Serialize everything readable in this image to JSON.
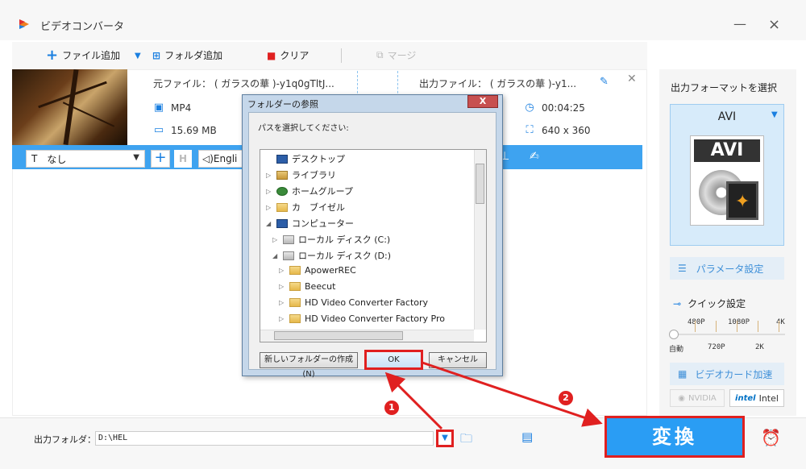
{
  "app": {
    "title": "ビデオコンバータ",
    "minimize_icon": "minimize-icon",
    "close_icon": "close-icon"
  },
  "toolbar": {
    "add_file_label": "ファイル追加",
    "add_folder_label": "フォルダ追加",
    "clear_label": "クリア",
    "merge_label": "マージ"
  },
  "file_item": {
    "source_label": "元ファイル： ( ガラスの華 )-y1q0gTltJ...",
    "output_label": "出力ファイル： ( ガラスの華 )-y1...",
    "format": "MP4",
    "size": "15.69 MB",
    "duration": "00:04:25",
    "resolution": "640 x 360",
    "subtitle_value": "なし",
    "audio_value": "Engli"
  },
  "right_panel": {
    "title": "出力フォーマットを選択",
    "format_name": "AVI",
    "format_image_text": "AVI",
    "param_button_label": "パラメータ設定",
    "quick_label": "クイック設定",
    "slider_top_ticks": [
      "480P",
      "1080P",
      "4K"
    ],
    "slider_bottom_ticks": [
      "自動",
      "720P",
      "2K"
    ],
    "gpu_label": "ビデオカード加速",
    "nvidia_label": "NVIDIA",
    "intel_logo": "intel",
    "intel_label": "Intel"
  },
  "bottom": {
    "output_folder_label": "出力フォルダ：",
    "output_folder_value": "D:\\HEL",
    "convert_label": "変換"
  },
  "dialog": {
    "title": "フォルダーの参照",
    "close_label": "X",
    "prompt": "パスを選択してください:",
    "tree": [
      {
        "label": "デスクトップ",
        "icon": "monitor"
      },
      {
        "label": "ライブラリ",
        "icon": "library"
      },
      {
        "label": "ホームグループ",
        "icon": "homegroup"
      },
      {
        "label": "カ　ブイゼル",
        "icon": "user-folder"
      },
      {
        "label": "コンピューター",
        "icon": "computer"
      },
      {
        "label": "ローカル ディスク (C:)",
        "icon": "drive"
      },
      {
        "label": "ローカル ディスク (D:)",
        "icon": "drive"
      },
      {
        "label": "ApowerREC",
        "icon": "folder"
      },
      {
        "label": "Beecut",
        "icon": "folder"
      },
      {
        "label": "HD Video Converter Factory",
        "icon": "folder"
      },
      {
        "label": "HD Video Converter Factory Pro",
        "icon": "folder"
      }
    ],
    "new_folder_label": "新しいフォルダーの作成(N)",
    "ok_label": "OK",
    "cancel_label": "キャンセル"
  },
  "annotations": {
    "badge1": "1",
    "badge2": "2",
    "accent_color": "#e02020"
  }
}
